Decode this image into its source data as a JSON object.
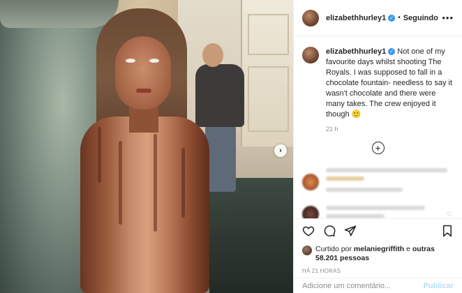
{
  "header": {
    "username": "elizabethhurley1",
    "separator": "•",
    "follow_status": "Seguindo",
    "more_icon": "ellipsis-icon",
    "verified_icon": "verified-badge-icon"
  },
  "caption": {
    "username": "elizabethhurley1",
    "text": " Not one of my favourite days whilst shooting The Royals. I was supposed to fall in a chocolate fountain- needless to say it wasn't chocolate and there were many takes. The crew enjoyed it though 🙂",
    "time": "21 h"
  },
  "load_more_icon": "plus-circle-icon",
  "actions": {
    "icons": [
      "heart-icon",
      "comment-icon",
      "share-icon",
      "bookmark-icon"
    ]
  },
  "likes": {
    "prefix": "Curtido por ",
    "user": "melaniegriffith",
    "middle": " e ",
    "others": "outras 58.201 pessoas"
  },
  "timestamp": "HÁ 21 HORAS",
  "comment_box": {
    "placeholder": "Adicione um comentário...",
    "publish_label": "Publicar"
  },
  "photo": {
    "next_icon": "chevron-right-icon"
  },
  "colors": {
    "verified": "#3897f0",
    "publish_disabled": "#b2dffc",
    "secondary_text": "#8e8e8e"
  }
}
